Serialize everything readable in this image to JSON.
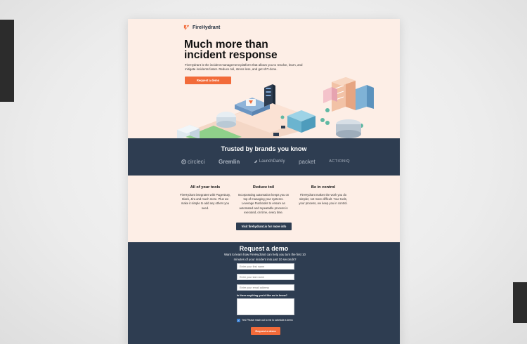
{
  "brand": {
    "name": "FireHydrant",
    "accent": "#f26b3a",
    "navy": "#2e3d51",
    "peach": "#fdeee6"
  },
  "hero": {
    "title_line1": "Much more than",
    "title_line2": "incident response",
    "description": "FireHydrant is the incident management platform that allows you to resolve, learn, and mitigate incidents faster. Reduce toil, stress less, and get sh*t done.",
    "cta_label": "Request a demo"
  },
  "trusted": {
    "title": "Trusted by brands you know",
    "brands": [
      "circleci",
      "Gremlin",
      "LaunchDarkly",
      "packet",
      "ACTIONIQ"
    ]
  },
  "features": {
    "items": [
      {
        "title": "All of your tools",
        "description": "FireHydrant integrates with PagerDuty, Slack, Jira and much more. Plus we make it simple to add any others you need."
      },
      {
        "title": "Reduce toil",
        "description": "Incorporating automation keeps you on top of managing your systems. Leverage Runbooks to ensure an automated and repeatable process is executed, on time, every time."
      },
      {
        "title": "Be in control",
        "description": "FireHydrant makes the work you do simpler, not more difficult. Your tools, your process, we keep you in control."
      }
    ],
    "cta_label": "Visit firehydrant.io for more info"
  },
  "demo": {
    "title": "Request a demo",
    "subtitle": "Want to learn how FireHydrant can help you turn the first 10 minutes of your incident into just 10 seconds?",
    "first_name_placeholder": "Enter your first name",
    "last_name_placeholder": "Enter your last name",
    "email_placeholder": "Enter your email address",
    "message_label": "Is there anything you'd like us to know?",
    "message_value": "",
    "checkbox_checked": true,
    "checkbox_label": "Yes! Please reach out to me to schedule a demo",
    "submit_label": "Request a demo"
  }
}
